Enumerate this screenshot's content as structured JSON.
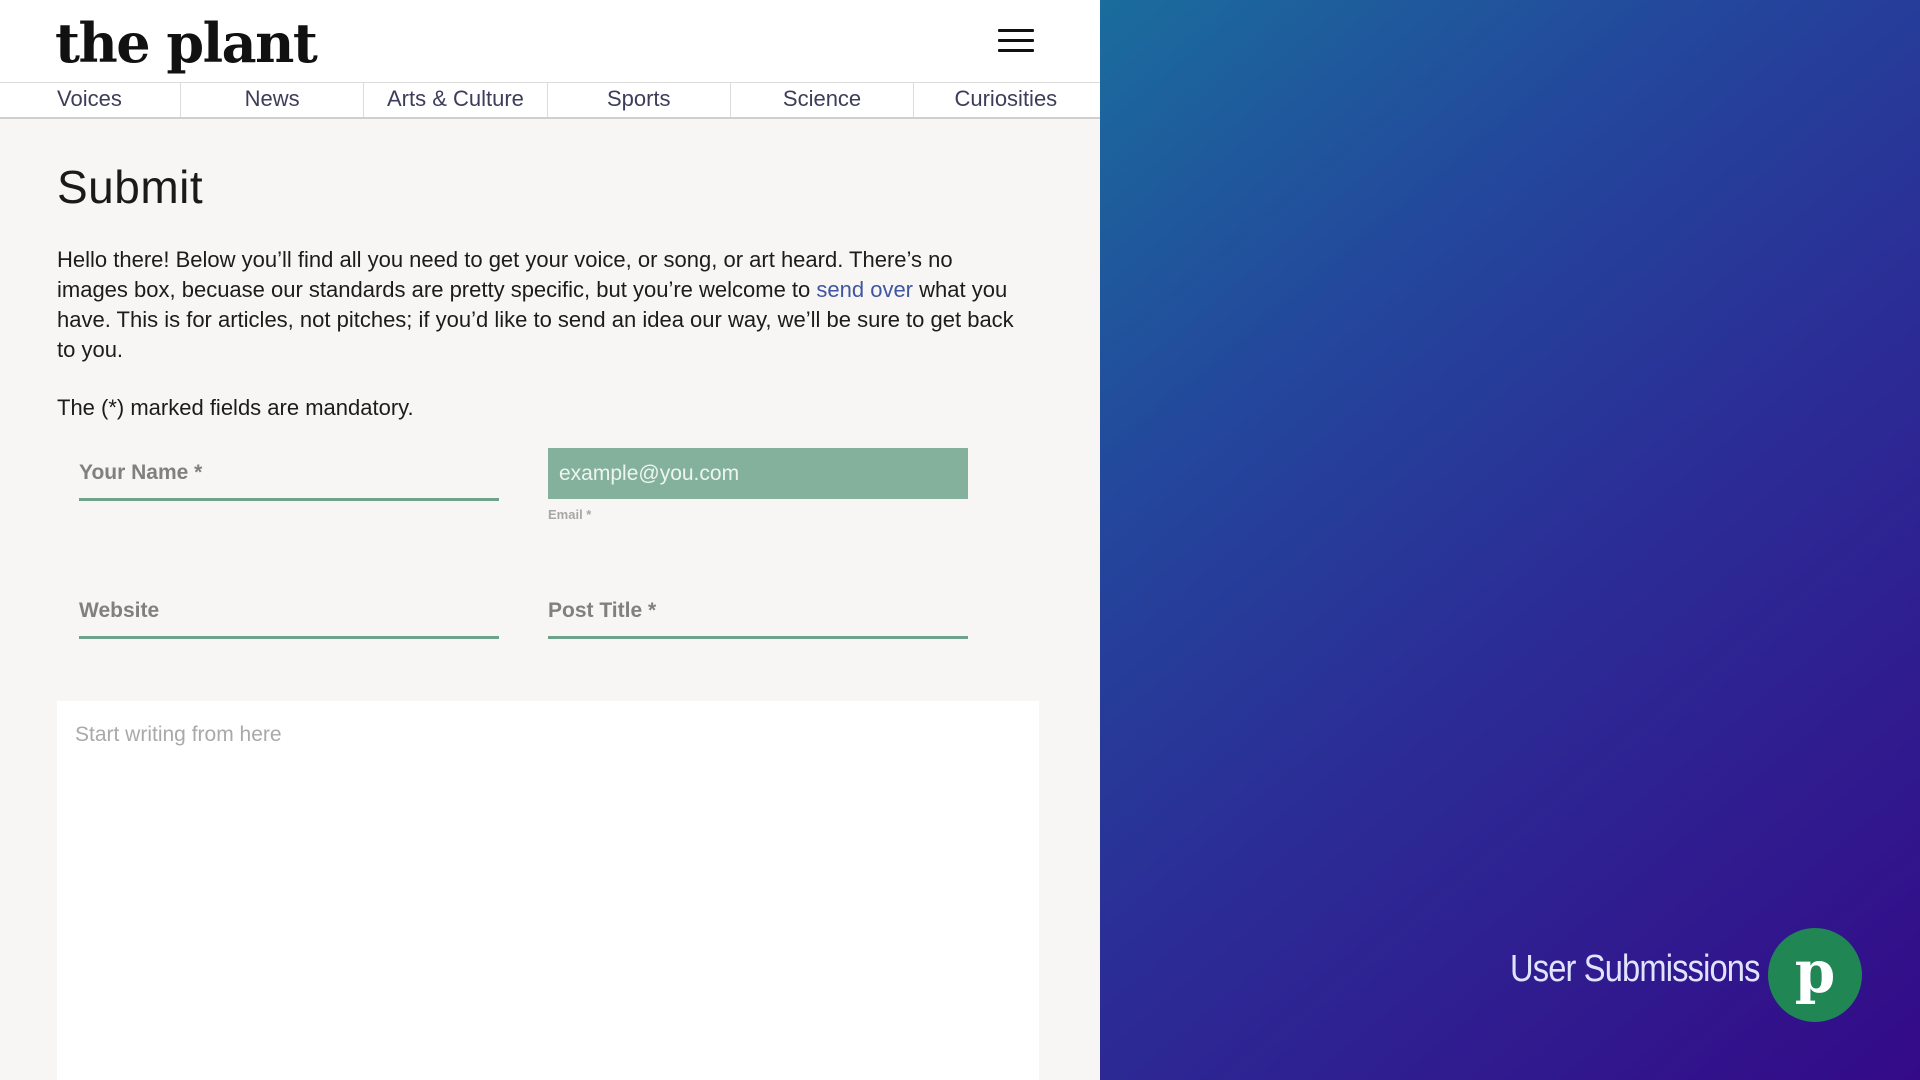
{
  "header": {
    "logo": "the plant",
    "menu_icon": "hamburger-icon"
  },
  "nav": {
    "items": [
      {
        "label": "Voices"
      },
      {
        "label": "News"
      },
      {
        "label": "Arts & Culture"
      },
      {
        "label": "Sports"
      },
      {
        "label": "Science"
      },
      {
        "label": "Curiosities"
      }
    ]
  },
  "main": {
    "title": "Submit",
    "intro_before": "Hello there! Below you’ll find all you need to get your voice, or song, or art heard. There’s no images box, becuase our standards are pretty specific, but you’re welcome to ",
    "intro_link": "send over",
    "intro_after": " what you have. This is for articles, not pitches; if you’d like to send an idea our way, we’ll be sure to get back to you.",
    "mandatory_note": "The (*) marked fields are mandatory."
  },
  "form": {
    "name_placeholder": "Your Name *",
    "email_placeholder": "example@you.com",
    "email_label": "Email *",
    "website_placeholder": "Website",
    "post_title_placeholder": "Post Title *",
    "body_placeholder": "Start writing from here"
  },
  "side_panel": {
    "tagline": "User Submissions",
    "badge_letter": "p",
    "badge_color": "#1f8654"
  }
}
